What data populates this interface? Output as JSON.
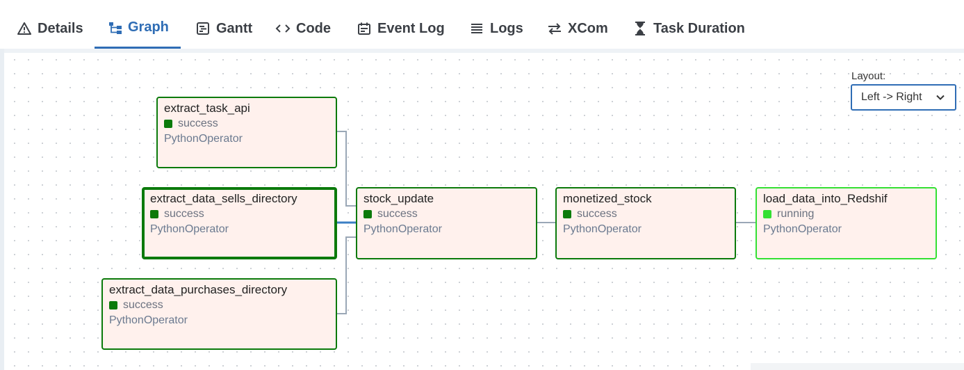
{
  "tabs": [
    {
      "label": "Details",
      "icon": "warning-icon"
    },
    {
      "label": "Graph",
      "icon": "graph-icon",
      "active": true
    },
    {
      "label": "Gantt",
      "icon": "gantt-icon"
    },
    {
      "label": "Code",
      "icon": "code-icon"
    },
    {
      "label": "Event Log",
      "icon": "calendar-icon"
    },
    {
      "label": "Logs",
      "icon": "lines-icon"
    },
    {
      "label": "XCom",
      "icon": "swap-icon"
    },
    {
      "label": "Task Duration",
      "icon": "hourglass-icon"
    }
  ],
  "layout": {
    "label": "Layout:",
    "selected": "Left -> Right"
  },
  "nodes": [
    {
      "name": "extract_task_api",
      "state": "success",
      "operator": "PythonOperator"
    },
    {
      "name": "extract_data_sells_directory",
      "state": "success",
      "operator": "PythonOperator"
    },
    {
      "name": "extract_data_purchases_directory",
      "state": "success",
      "operator": "PythonOperator"
    },
    {
      "name": "stock_update",
      "state": "success",
      "operator": "PythonOperator"
    },
    {
      "name": "monetized_stock",
      "state": "success",
      "operator": "PythonOperator"
    },
    {
      "name": "load_data_into_Redshif",
      "state": "running",
      "operator": "PythonOperator"
    }
  ],
  "colors": {
    "success": "#0b7a0b",
    "running": "#33e033",
    "accent": "#2f6db5",
    "node_bg": "#fff1ed"
  }
}
